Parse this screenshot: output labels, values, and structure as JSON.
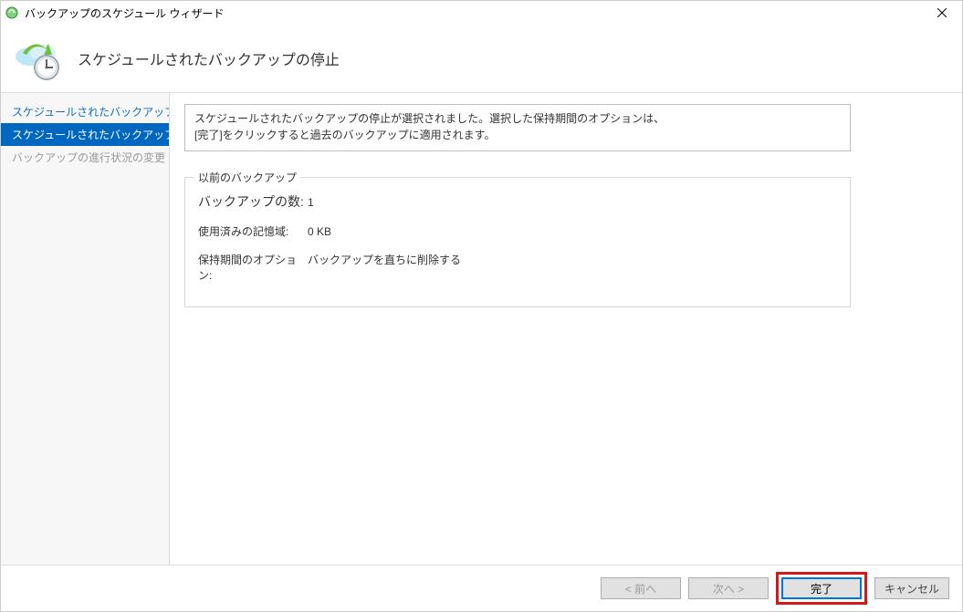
{
  "window": {
    "title": "バックアップのスケジュール ウィザード"
  },
  "header": {
    "title": "スケジュールされたバックアップの停止"
  },
  "sidebar": {
    "steps": [
      {
        "label": "スケジュールされたバックアップを変..."
      },
      {
        "label": "スケジュールされたバックアップの停"
      },
      {
        "label": "バックアップの進行状況の変更"
      }
    ]
  },
  "content": {
    "info_line1": "スケジュールされたバックアップの停止が選択されました。選択した保持期間のオプションは、",
    "info_line2": "[完了]をクリックすると過去のバックアップに適用されます。",
    "fieldset_title": "以前のバックアップ",
    "rows": {
      "count_label": "バックアップの数:",
      "count_value": "1",
      "storage_label": "使用済みの記憶域:",
      "storage_value": "0 KB",
      "retention_label": "保持期間のオプション:",
      "retention_value": "バックアップを直ちに削除する"
    }
  },
  "footer": {
    "prev": "< 前へ",
    "next": "次へ >",
    "finish": "完了",
    "cancel": "キャンセル"
  }
}
